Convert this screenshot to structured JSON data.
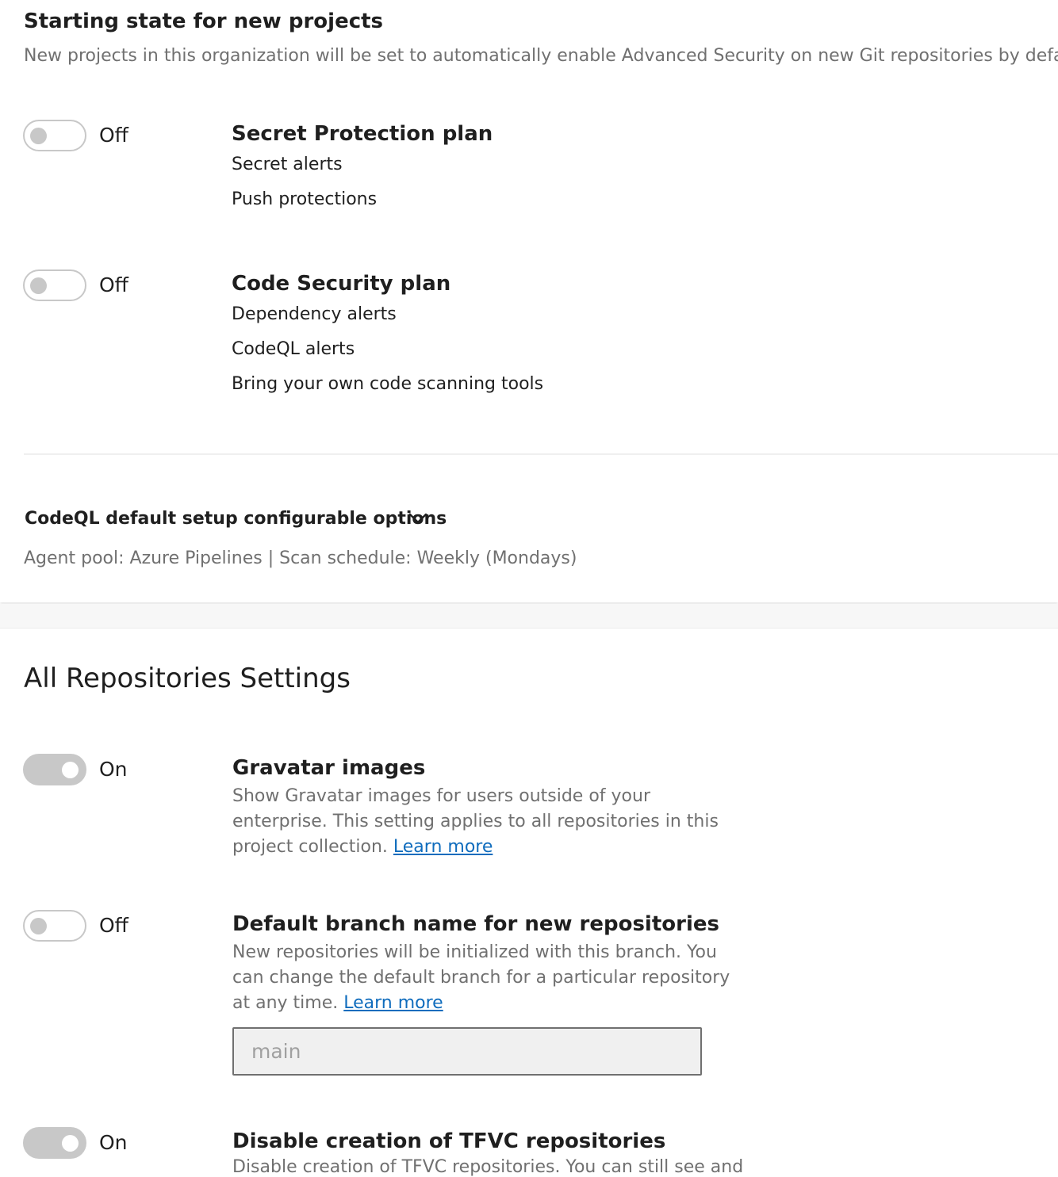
{
  "starting_state": {
    "title": "Starting state for new projects",
    "description": "New projects in this organization will be set to automatically enable Advanced Security on new Git repositories by default. S"
  },
  "plans": [
    {
      "state": "Off",
      "title": "Secret Protection plan",
      "items": [
        "Secret alerts",
        "Push protections"
      ]
    },
    {
      "state": "Off",
      "title": "Code Security plan",
      "items": [
        "Dependency alerts",
        "CodeQL alerts",
        "Bring your own code scanning tools"
      ]
    }
  ],
  "codeql": {
    "title": "CodeQL default setup configurable options",
    "icon": "chevron-down-icon",
    "summary": "Agent pool: Azure Pipelines | Scan schedule: Weekly (Mondays)"
  },
  "repositories": {
    "heading": "All Repositories Settings",
    "settings": [
      {
        "state": "On",
        "title": "Gravatar images",
        "description": "Show Gravatar images for users outside of your enterprise. This setting applies to all repositories in this project collection.",
        "link": "Learn more"
      },
      {
        "state": "Off",
        "title": "Default branch name for new repositories",
        "description": "New repositories will be initialized with this branch. You can change the default branch for a particular repository at any time.",
        "link": "Learn more",
        "input_placeholder": "main"
      },
      {
        "state": "On",
        "title": "Disable creation of TFVC repositories",
        "description": "Disable creation of TFVC repositories. You can still see and"
      }
    ]
  },
  "colors": {
    "link": "#0f6cbd",
    "toggle_off_track": "#c8c8c8",
    "muted_text": "#707070"
  }
}
